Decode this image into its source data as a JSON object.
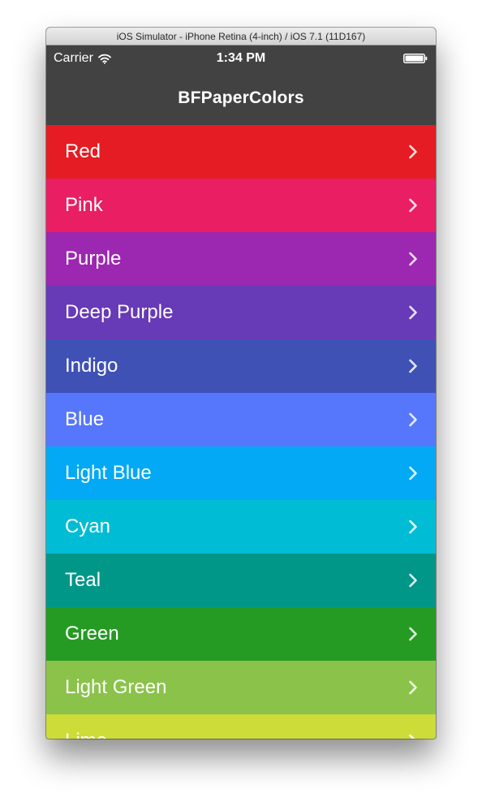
{
  "window": {
    "title": "iOS Simulator - iPhone Retina (4-inch) / iOS 7.1 (11D167)"
  },
  "status_bar": {
    "carrier": "Carrier",
    "time": "1:34 PM",
    "icons": [
      "wifi-icon",
      "battery-icon"
    ]
  },
  "nav": {
    "title": "BFPaperColors"
  },
  "colors": {
    "titlebar_text": "#2a2a2a",
    "navbar_bg": "#424242",
    "row_text": "#ffffff"
  },
  "list": {
    "items": [
      {
        "label": "Red",
        "color": "#e51c23"
      },
      {
        "label": "Pink",
        "color": "#e91e63"
      },
      {
        "label": "Purple",
        "color": "#9c27b0"
      },
      {
        "label": "Deep Purple",
        "color": "#673ab7"
      },
      {
        "label": "Indigo",
        "color": "#3f51b5"
      },
      {
        "label": "Blue",
        "color": "#5677fc"
      },
      {
        "label": "Light Blue",
        "color": "#03a9f4"
      },
      {
        "label": "Cyan",
        "color": "#00bcd4"
      },
      {
        "label": "Teal",
        "color": "#009688"
      },
      {
        "label": "Green",
        "color": "#259b24"
      },
      {
        "label": "Light Green",
        "color": "#8bc34a"
      },
      {
        "label": "Lime",
        "color": "#cddc39"
      }
    ],
    "row_icon": "chevron-right-icon"
  }
}
